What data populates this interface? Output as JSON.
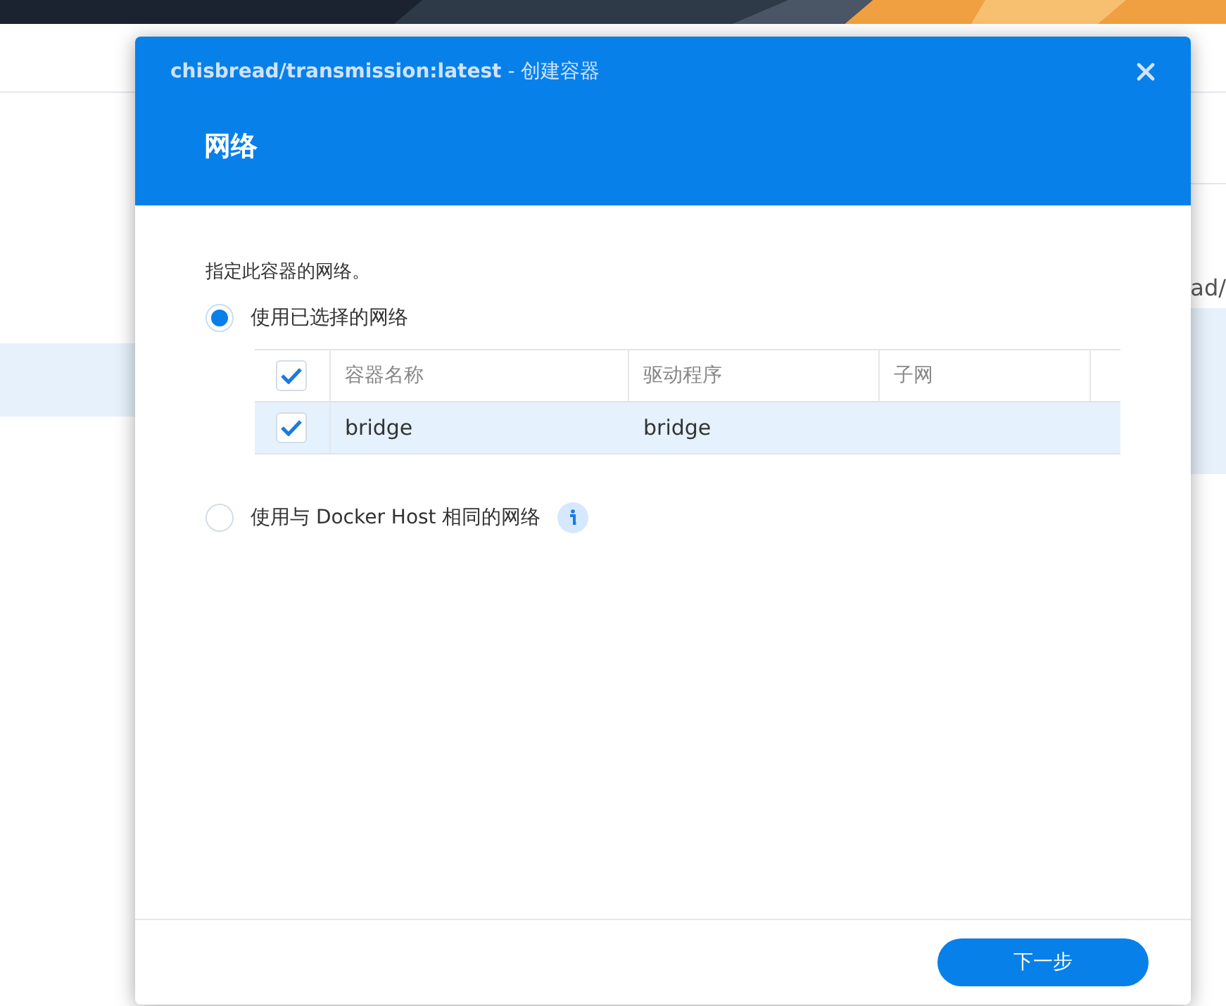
{
  "background": {
    "side_text": "ad/"
  },
  "dialog": {
    "title": "chisbread/transmission:latest",
    "title_suffix": " - 创建容器",
    "step_title": "网络",
    "description": "指定此容器的网络。",
    "options": [
      {
        "label": "使用已选择的网络",
        "selected": true,
        "kind": "table"
      },
      {
        "label": "使用与 Docker Host 相同的网络",
        "selected": false,
        "kind": "info"
      }
    ],
    "table": {
      "header_checked": true,
      "columns": [
        "容器名称",
        "驱动程序",
        "子网"
      ],
      "rows": [
        {
          "checked": true,
          "selected": true,
          "cells": [
            "bridge",
            "bridge",
            ""
          ]
        }
      ]
    },
    "next_button": "下一步"
  }
}
